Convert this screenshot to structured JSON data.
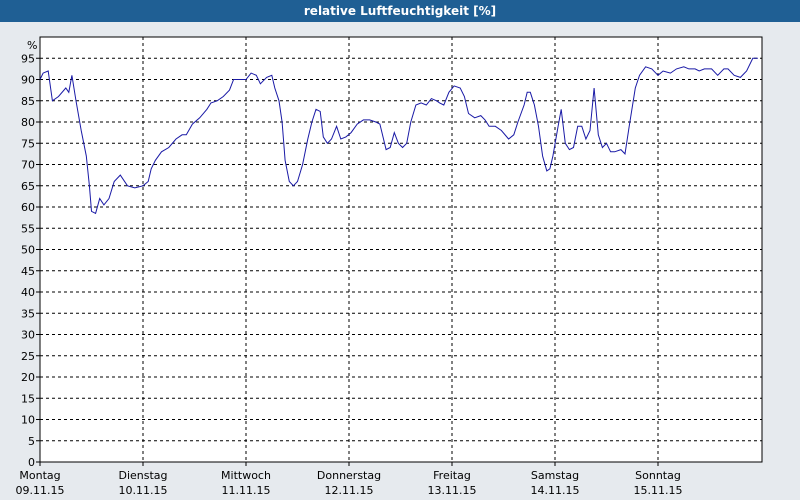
{
  "window": {
    "title": "relative Luftfeuchtigkeit [%]"
  },
  "colors": {
    "line": "#1a1aa6",
    "titlebar": "#1f5f94",
    "plot_bg": "#ffffff",
    "grid": "#000000"
  },
  "chart_data": {
    "type": "line",
    "title": "relative Luftfeuchtigkeit [%]",
    "ylabel": "%",
    "ylim": [
      0,
      100
    ],
    "yticks": [
      0,
      5,
      10,
      15,
      20,
      25,
      30,
      35,
      40,
      45,
      50,
      55,
      60,
      65,
      70,
      75,
      80,
      85,
      90,
      95
    ],
    "grid": true,
    "xlim": [
      0,
      7
    ],
    "xticks": [
      {
        "day": "Montag",
        "date": "09.11.15"
      },
      {
        "day": "Dienstag",
        "date": "10.11.15"
      },
      {
        "day": "Mittwoch",
        "date": "11.11.15"
      },
      {
        "day": "Donnerstag",
        "date": "12.11.15"
      },
      {
        "day": "Freitag",
        "date": "13.11.15"
      },
      {
        "day": "Samstag",
        "date": "14.11.15"
      },
      {
        "day": "Sonntag",
        "date": "15.11.15"
      }
    ],
    "series": [
      {
        "points": [
          [
            0.0,
            90
          ],
          [
            0.03,
            91.5
          ],
          [
            0.08,
            92
          ],
          [
            0.12,
            85
          ],
          [
            0.18,
            86
          ],
          [
            0.25,
            88
          ],
          [
            0.28,
            87
          ],
          [
            0.31,
            91
          ],
          [
            0.35,
            85
          ],
          [
            0.4,
            78
          ],
          [
            0.45,
            72
          ],
          [
            0.48,
            65
          ],
          [
            0.5,
            59
          ],
          [
            0.54,
            58.5
          ],
          [
            0.58,
            62
          ],
          [
            0.62,
            60.5
          ],
          [
            0.67,
            62
          ],
          [
            0.72,
            66
          ],
          [
            0.78,
            67.5
          ],
          [
            0.85,
            65
          ],
          [
            0.92,
            64.5
          ],
          [
            1.0,
            65
          ],
          [
            1.05,
            66
          ],
          [
            1.08,
            69
          ],
          [
            1.12,
            71
          ],
          [
            1.18,
            73
          ],
          [
            1.25,
            74
          ],
          [
            1.32,
            76
          ],
          [
            1.38,
            77
          ],
          [
            1.42,
            77
          ],
          [
            1.48,
            79.5
          ],
          [
            1.55,
            81
          ],
          [
            1.62,
            83
          ],
          [
            1.66,
            84.5
          ],
          [
            1.72,
            85
          ],
          [
            1.78,
            86
          ],
          [
            1.84,
            87.5
          ],
          [
            1.88,
            90
          ],
          [
            1.93,
            90
          ],
          [
            2.0,
            90
          ],
          [
            2.05,
            91.5
          ],
          [
            2.1,
            91
          ],
          [
            2.14,
            89
          ],
          [
            2.2,
            90.5
          ],
          [
            2.25,
            91
          ],
          [
            2.28,
            88
          ],
          [
            2.32,
            85
          ],
          [
            2.35,
            80
          ],
          [
            2.38,
            71
          ],
          [
            2.42,
            66
          ],
          [
            2.46,
            65
          ],
          [
            2.5,
            66
          ],
          [
            2.55,
            70
          ],
          [
            2.6,
            76
          ],
          [
            2.64,
            80
          ],
          [
            2.68,
            83
          ],
          [
            2.72,
            82.5
          ],
          [
            2.75,
            76.5
          ],
          [
            2.79,
            75
          ],
          [
            2.83,
            76
          ],
          [
            2.88,
            79
          ],
          [
            2.92,
            76
          ],
          [
            2.97,
            76.5
          ],
          [
            3.02,
            77.5
          ],
          [
            3.08,
            79.5
          ],
          [
            3.14,
            80.5
          ],
          [
            3.2,
            80.5
          ],
          [
            3.26,
            80
          ],
          [
            3.3,
            79.5
          ],
          [
            3.33,
            76.5
          ],
          [
            3.36,
            73.5
          ],
          [
            3.4,
            74
          ],
          [
            3.44,
            77.5
          ],
          [
            3.48,
            75
          ],
          [
            3.52,
            74
          ],
          [
            3.56,
            75
          ],
          [
            3.6,
            80
          ],
          [
            3.65,
            84
          ],
          [
            3.7,
            84.5
          ],
          [
            3.75,
            84
          ],
          [
            3.8,
            85.5
          ],
          [
            3.85,
            85
          ],
          [
            3.88,
            84.5
          ],
          [
            3.92,
            84
          ],
          [
            3.97,
            87
          ],
          [
            4.02,
            88.5
          ],
          [
            4.08,
            88
          ],
          [
            4.12,
            86
          ],
          [
            4.16,
            82
          ],
          [
            4.22,
            81
          ],
          [
            4.28,
            81.5
          ],
          [
            4.32,
            80.5
          ],
          [
            4.36,
            79
          ],
          [
            4.42,
            79
          ],
          [
            4.48,
            78
          ],
          [
            4.55,
            76
          ],
          [
            4.6,
            77
          ],
          [
            4.64,
            80
          ],
          [
            4.7,
            84
          ],
          [
            4.73,
            87
          ],
          [
            4.76,
            87
          ],
          [
            4.8,
            84
          ],
          [
            4.84,
            79
          ],
          [
            4.88,
            72
          ],
          [
            4.92,
            68.5
          ],
          [
            4.95,
            69
          ],
          [
            4.98,
            72
          ],
          [
            5.03,
            79
          ],
          [
            5.06,
            83
          ],
          [
            5.1,
            75
          ],
          [
            5.14,
            73.5
          ],
          [
            5.18,
            74
          ],
          [
            5.22,
            79
          ],
          [
            5.26,
            79
          ],
          [
            5.3,
            76
          ],
          [
            5.34,
            78
          ],
          [
            5.38,
            88
          ],
          [
            5.42,
            77
          ],
          [
            5.46,
            74
          ],
          [
            5.5,
            75
          ],
          [
            5.54,
            73
          ],
          [
            5.58,
            73
          ],
          [
            5.64,
            73.5
          ],
          [
            5.68,
            72.5
          ],
          [
            5.72,
            79
          ],
          [
            5.78,
            88
          ],
          [
            5.82,
            91
          ],
          [
            5.88,
            93
          ],
          [
            5.94,
            92.5
          ],
          [
            6.0,
            91
          ],
          [
            6.05,
            92
          ],
          [
            6.12,
            91.5
          ],
          [
            6.18,
            92.5
          ],
          [
            6.25,
            93
          ],
          [
            6.3,
            92.5
          ],
          [
            6.36,
            92.5
          ],
          [
            6.4,
            92
          ],
          [
            6.45,
            92.5
          ],
          [
            6.52,
            92.5
          ],
          [
            6.58,
            91
          ],
          [
            6.64,
            92.5
          ],
          [
            6.68,
            92.5
          ],
          [
            6.74,
            91
          ],
          [
            6.8,
            90.5
          ],
          [
            6.86,
            92
          ],
          [
            6.92,
            95
          ],
          [
            6.97,
            95
          ]
        ]
      }
    ]
  }
}
